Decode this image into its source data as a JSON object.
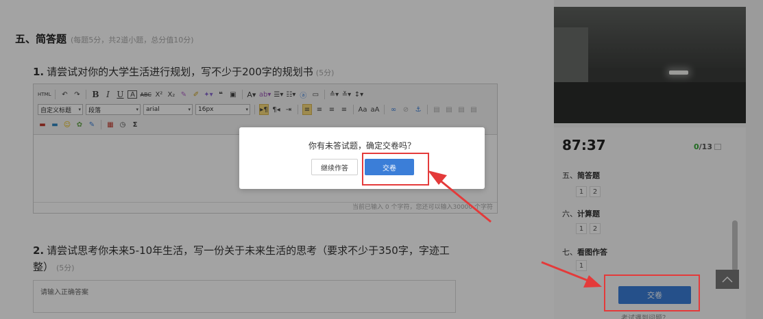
{
  "section": {
    "title": "五、简答题",
    "note": "(每题5分，共2道小题，总分值10分)"
  },
  "questions": [
    {
      "num": "1.",
      "text": "请尝试对你的大学生活进行规划，写不少于200字的规划书",
      "points": "(5分)"
    },
    {
      "num": "2.",
      "text": "请尝试思考你未来5-10年生活，写一份关于未来生活的思考（要求不少于350字，字迹工整）",
      "points": "(5分)"
    }
  ],
  "editor": {
    "heading_select": "自定义标题",
    "para_select": "段落",
    "font_select": "arial",
    "size_select": "16px",
    "status": "当前已输入 0 个字符，您还可以输入30000 个字符"
  },
  "answer_placeholder": "请输入正确答案",
  "timer": "87:37",
  "progress": {
    "done": "0",
    "total": "/13"
  },
  "groups": [
    {
      "prefix": "五、",
      "name": "简答题",
      "items": [
        "1",
        "2"
      ]
    },
    {
      "prefix": "六、",
      "name": "计算题",
      "items": [
        "1",
        "2"
      ]
    },
    {
      "prefix": "七、",
      "name": "看图作答",
      "items": [
        "1"
      ]
    }
  ],
  "submit_label": "交卷",
  "problem_link": "考试遇到问题？",
  "dialog": {
    "message": "你有未答试题，确定交卷吗？",
    "continue_label": "继续作答",
    "submit_label": "交卷"
  },
  "colors": {
    "accent": "#3b7ed8",
    "highlight": "#e43a3a",
    "done": "#35a835"
  }
}
